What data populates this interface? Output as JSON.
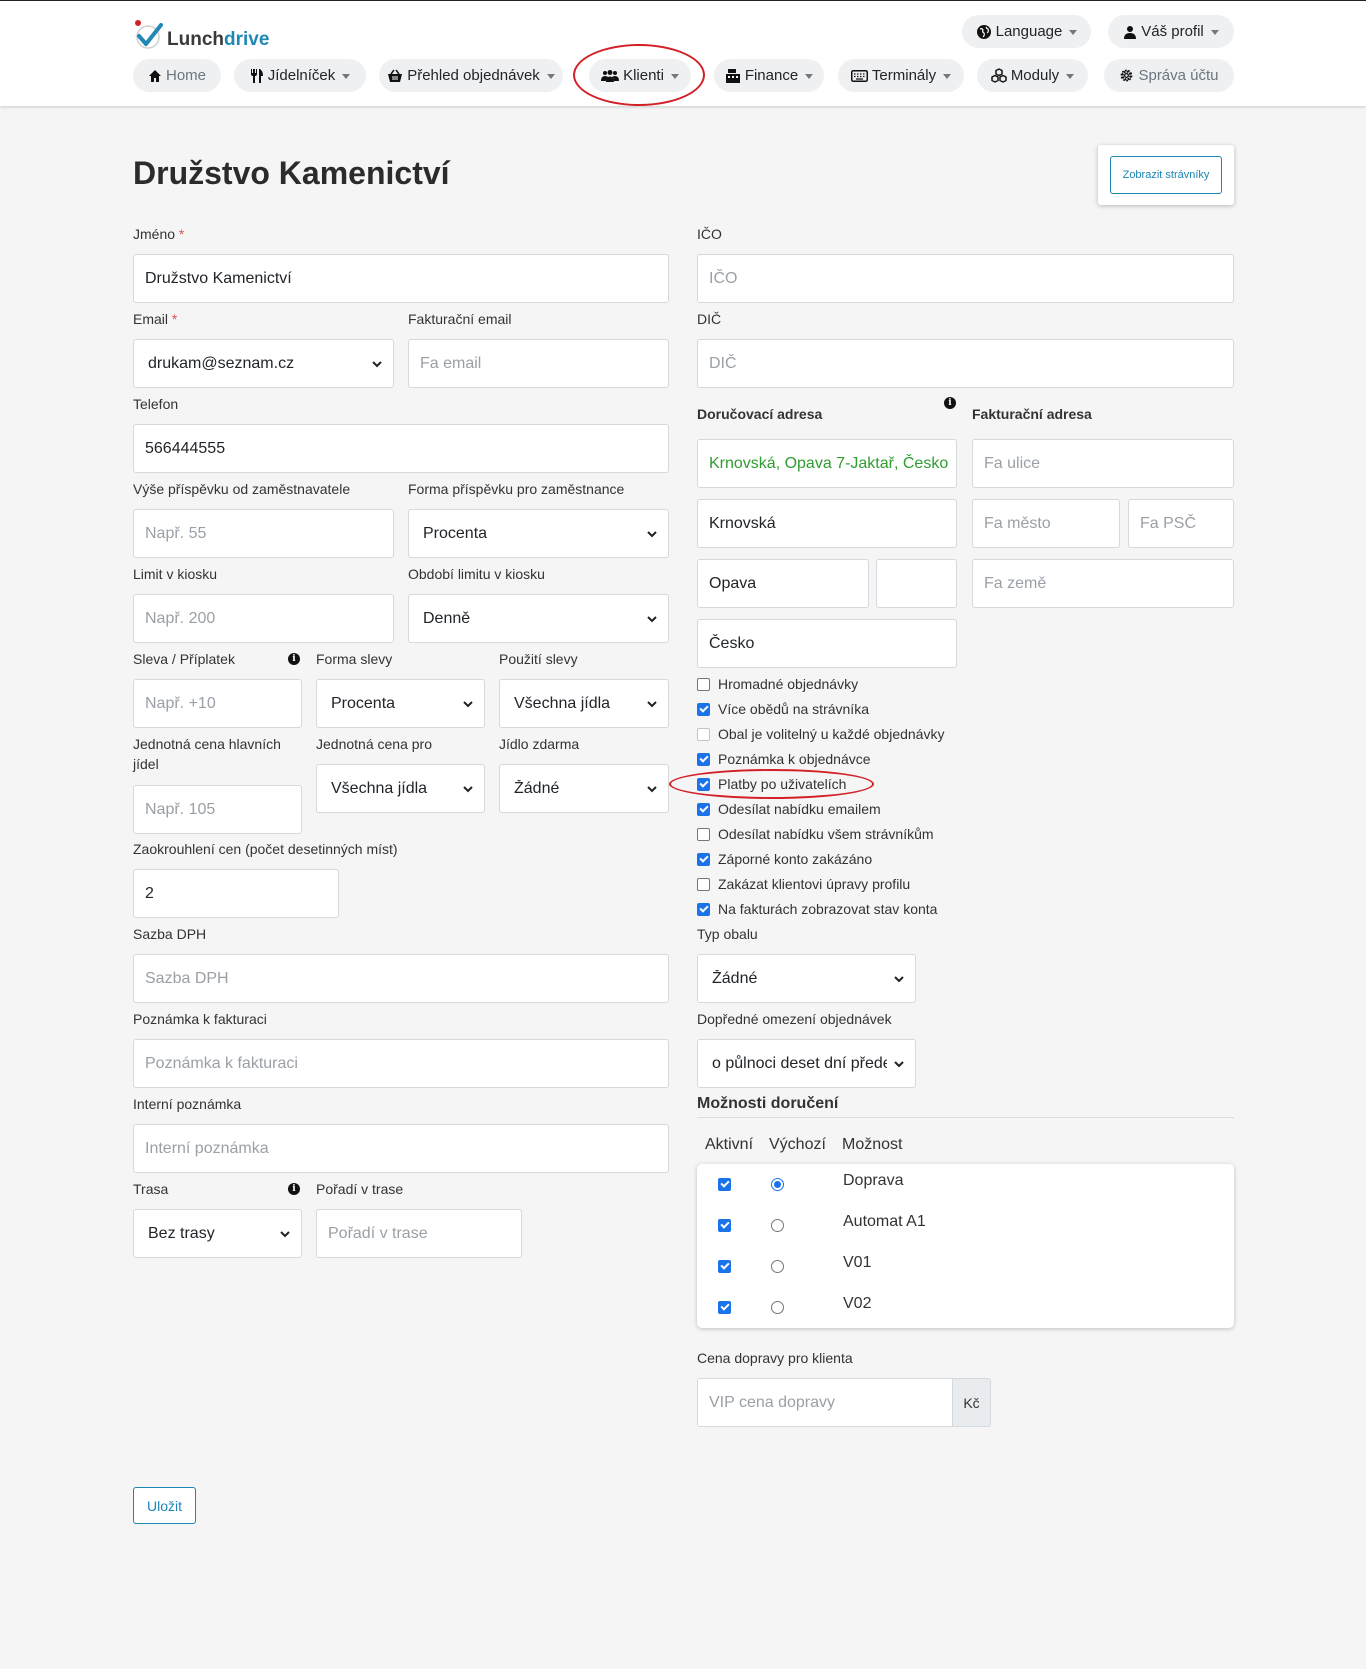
{
  "brand": {
    "name_part1": "Lunch",
    "name_part2": "drive"
  },
  "colors": {
    "accent": "#1c86b5",
    "annotation": "#d31f26",
    "check": "#1a73e8",
    "address_text": "#2f9d2f"
  },
  "topnav": {
    "language": "Language",
    "profile": "Váš profil",
    "items": [
      {
        "label": "Home",
        "icon": "home-icon"
      },
      {
        "label": "Jídelníček",
        "icon": "cutlery-icon"
      },
      {
        "label": "Přehled objednávek",
        "icon": "basket-icon"
      },
      {
        "label": "Klienti",
        "icon": "users-icon"
      },
      {
        "label": "Finance",
        "icon": "cash-register-icon"
      },
      {
        "label": "Terminály",
        "icon": "keyboard-icon"
      },
      {
        "label": "Moduly",
        "icon": "cubes-icon"
      },
      {
        "label": "Správa účtu",
        "icon": "gear-icon"
      }
    ]
  },
  "page": {
    "title": "Družstvo Kamenictví",
    "show_diners_button": "Zobrazit strávníky"
  },
  "form": {
    "name": {
      "label": "Jméno",
      "value": "Družstvo Kamenictví"
    },
    "email": {
      "label": "Email",
      "value": "drukam@seznam.cz"
    },
    "billing_email": {
      "label": "Fakturační email",
      "placeholder": "Fa email"
    },
    "phone": {
      "label": "Telefon",
      "value": "566444555"
    },
    "employer_contribution": {
      "label": "Výše příspěvku od zaměstnavatele",
      "placeholder": "Např. 55"
    },
    "contribution_form": {
      "label": "Forma příspěvku pro zaměstnance",
      "value": "Procenta"
    },
    "kiosk_limit": {
      "label": "Limit v kiosku",
      "placeholder": "Např. 200"
    },
    "kiosk_period": {
      "label": "Období limitu v kiosku",
      "value": "Denně"
    },
    "discount": {
      "label": "Sleva / Příplatek",
      "placeholder": "Např. +10"
    },
    "discount_form": {
      "label": "Forma slevy",
      "value": "Procenta"
    },
    "discount_use": {
      "label": "Použití slevy",
      "value": "Všechna jídla"
    },
    "unit_price_main": {
      "label": "Jednotná cena hlavních jídel",
      "placeholder": "Např. 105"
    },
    "unit_price_for": {
      "label": "Jednotná cena pro",
      "value": "Všechna jídla"
    },
    "free_meal": {
      "label": "Jídlo zdarma",
      "value": "Žádné"
    },
    "rounding": {
      "label": "Zaokrouhlení cen (počet desetinných míst)",
      "value": "2"
    },
    "vat": {
      "label": "Sazba DPH",
      "placeholder": "Sazba DPH"
    },
    "invoice_note": {
      "label": "Poznámka k fakturaci",
      "placeholder": "Poznámka k fakturaci"
    },
    "internal_note": {
      "label": "Interní poznámka",
      "placeholder": "Interní poznámka"
    },
    "route": {
      "label": "Trasa",
      "value": "Bez trasy"
    },
    "route_order": {
      "label": "Pořadí v trase",
      "placeholder": "Pořadí v trase"
    },
    "ico": {
      "label": "IČO",
      "placeholder": "IČO"
    },
    "dic": {
      "label": "DIČ",
      "placeholder": "DIČ"
    },
    "delivery_address": {
      "label": "Doručovací adresa",
      "full": "Krnovská, Opava 7-Jaktař, Česko",
      "street": "Krnovská",
      "city": "Opava",
      "zip": "",
      "country": "Česko"
    },
    "billing_address": {
      "label": "Fakturační adresa",
      "street_placeholder": "Fa ulice",
      "city_placeholder": "Fa město",
      "zip_placeholder": "Fa PSČ",
      "country_placeholder": "Fa země"
    },
    "checkboxes": [
      {
        "label": "Hromadné objednávky",
        "checked": false,
        "disabled": false
      },
      {
        "label": "Více obědů na strávníka",
        "checked": true,
        "disabled": false
      },
      {
        "label": "Obal je volitelný u každé objednávky",
        "checked": false,
        "disabled": true
      },
      {
        "label": "Poznámka k objednávce",
        "checked": true,
        "disabled": false
      },
      {
        "label": "Platby po uživatelích",
        "checked": true,
        "disabled": false
      },
      {
        "label": "Odesílat nabídku emailem",
        "checked": true,
        "disabled": false
      },
      {
        "label": "Odesílat nabídku všem strávníkům",
        "checked": false,
        "disabled": false
      },
      {
        "label": "Záporné konto zakázáno",
        "checked": true,
        "disabled": false
      },
      {
        "label": "Zakázat klientovi úpravy profilu",
        "checked": false,
        "disabled": false
      },
      {
        "label": "Na fakturách zobrazovat stav konta",
        "checked": true,
        "disabled": false
      }
    ],
    "package_type": {
      "label": "Typ obalu",
      "value": "Žádné"
    },
    "order_limit": {
      "label": "Dopředné omezení objednávek",
      "value": "o půlnoci deset dní předem"
    },
    "delivery_options": {
      "title": "Možnosti doručení",
      "headers": [
        "Aktivní",
        "Výchozí",
        "Možnost"
      ],
      "rows": [
        {
          "name": "Doprava",
          "active": true,
          "default": true
        },
        {
          "name": "Automat A1",
          "active": true,
          "default": false
        },
        {
          "name": "V01",
          "active": true,
          "default": false
        },
        {
          "name": "V02",
          "active": true,
          "default": false
        }
      ]
    },
    "delivery_price": {
      "label": "Cena dopravy pro klienta",
      "placeholder": "VIP cena dopravy",
      "currency": "Kč"
    },
    "save": "Uložit"
  }
}
